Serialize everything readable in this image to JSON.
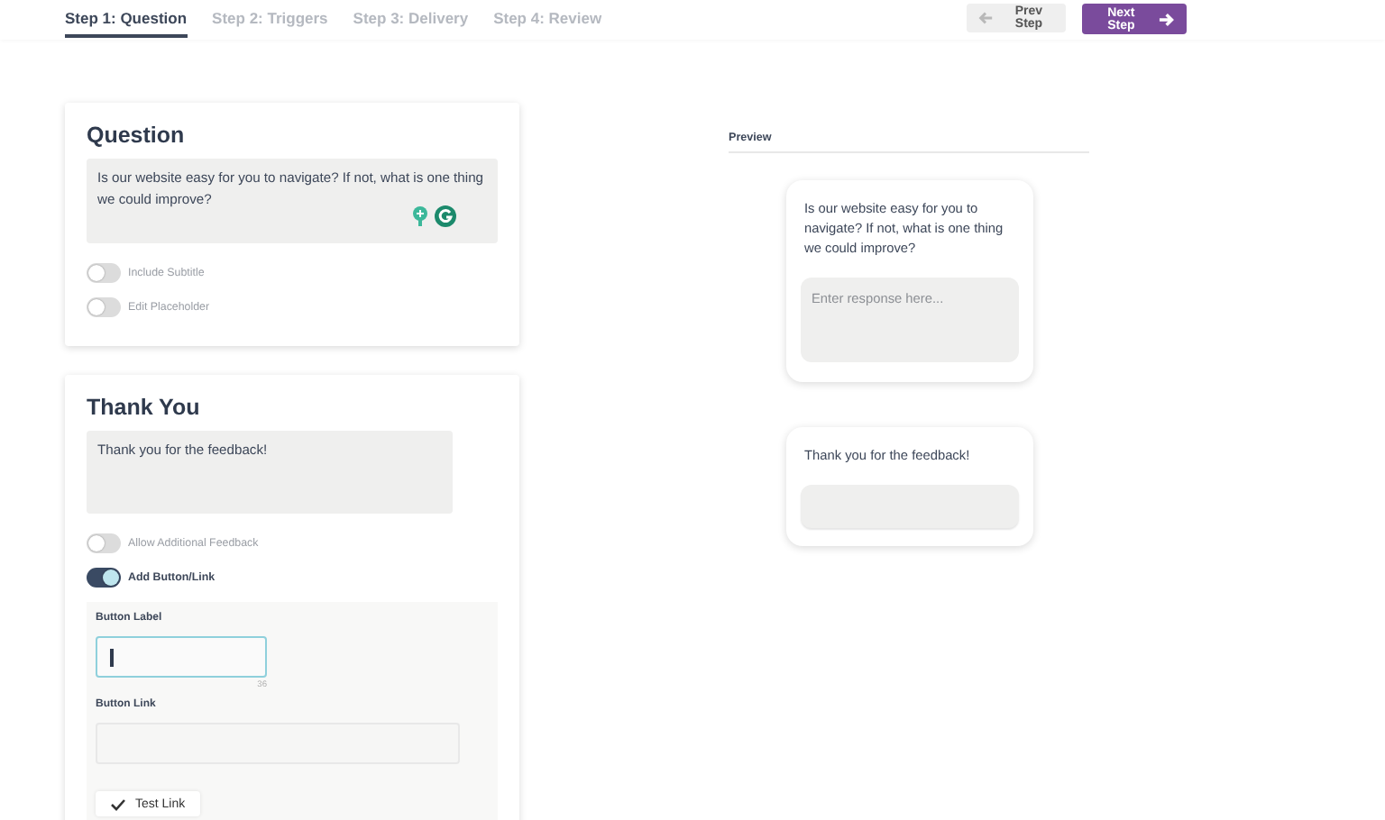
{
  "steps": [
    {
      "label": "Step 1: Question",
      "selected": true
    },
    {
      "label": "Step 2: Triggers",
      "selected": false
    },
    {
      "label": "Step 3: Delivery",
      "selected": false
    },
    {
      "label": "Step 4: Review",
      "selected": false
    }
  ],
  "nav_buttons": {
    "prev": "Prev Step",
    "next": "Next Step"
  },
  "question_card": {
    "title": "Question",
    "text": "Is our website easy for you to navigate? If not, what is one thing we could improve?",
    "toggles": [
      {
        "label": "Include Subtitle",
        "on": false
      },
      {
        "label": "Edit Placeholder",
        "on": false
      }
    ]
  },
  "thank_you_card": {
    "title": "Thank You",
    "text": "Thank you for the feedback!",
    "toggles": [
      {
        "label": "Allow Additional Feedback",
        "on": false
      },
      {
        "label": "Add Button/Link",
        "on": true
      }
    ],
    "button_settings": {
      "label_field": {
        "label": "Button Label",
        "focused": true,
        "counter": "36"
      },
      "link_field": {
        "label": "Button Link",
        "focused": false
      },
      "test_button": "Test Link"
    }
  },
  "preview": {
    "title": "Preview",
    "question": "Is our website easy for you to navigate? If not, what is one thing we could improve?",
    "response_placeholder": "Enter response here...",
    "thank_you": "Thank you for the feedback!"
  }
}
